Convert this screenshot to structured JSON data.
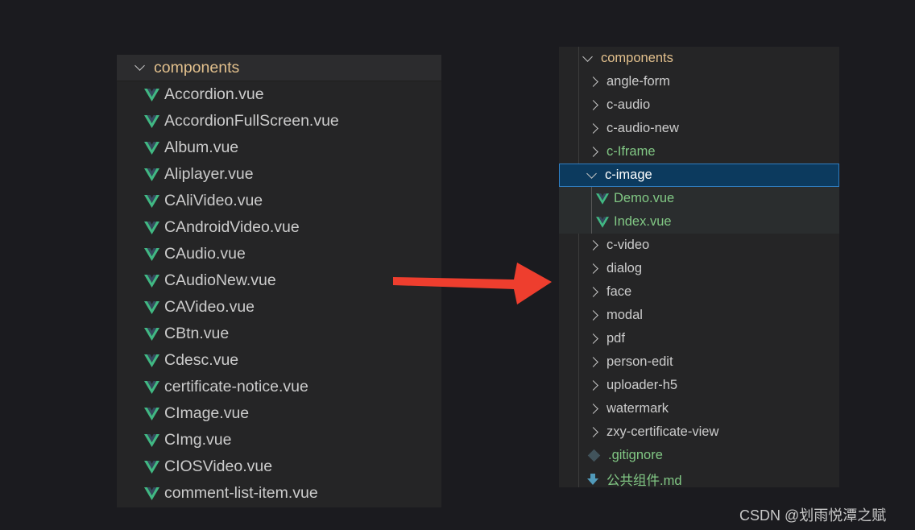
{
  "left_tree": {
    "folder_label": "components",
    "files": [
      "Accordion.vue",
      "AccordionFullScreen.vue",
      "Album.vue",
      "Aliplayer.vue",
      "CAliVideo.vue",
      "CAndroidVideo.vue",
      "CAudio.vue",
      "CAudioNew.vue",
      "CAVideo.vue",
      "CBtn.vue",
      "Cdesc.vue",
      "certificate-notice.vue",
      "CImage.vue",
      "CImg.vue",
      "CIOSVideo.vue",
      "comment-list-item.vue"
    ]
  },
  "right_tree": {
    "folder_label": "components",
    "items": [
      {
        "label": "angle-form",
        "type": "folder"
      },
      {
        "label": "c-audio",
        "type": "folder"
      },
      {
        "label": "c-audio-new",
        "type": "folder"
      },
      {
        "label": "c-Iframe",
        "type": "folder",
        "color": "#81c784"
      },
      {
        "label": "c-image",
        "type": "folder-open",
        "selected": true
      },
      {
        "label": "Demo.vue",
        "type": "vue-file",
        "child": true
      },
      {
        "label": "Index.vue",
        "type": "vue-file",
        "child": true
      },
      {
        "label": "c-video",
        "type": "folder"
      },
      {
        "label": "dialog",
        "type": "folder"
      },
      {
        "label": "face",
        "type": "folder"
      },
      {
        "label": "modal",
        "type": "folder"
      },
      {
        "label": "pdf",
        "type": "folder"
      },
      {
        "label": "person-edit",
        "type": "folder"
      },
      {
        "label": "uploader-h5",
        "type": "folder"
      },
      {
        "label": "watermark",
        "type": "folder"
      },
      {
        "label": "zxy-certificate-view",
        "type": "folder"
      },
      {
        "label": ".gitignore",
        "type": "gitignore"
      },
      {
        "label": "公共组件.md",
        "type": "markdown"
      }
    ]
  },
  "watermark_text": "CSDN @划雨悦潭之赋",
  "colors": {
    "background": "#1b1b1f",
    "panel": "#252526",
    "folder_text": "#e2c08d",
    "vue_green": "#41b883",
    "vue_dark": "#35495e",
    "git_modified_green": "#81c784",
    "selection": "#0c3a5e",
    "arrow_red": "#ee3e2e"
  }
}
